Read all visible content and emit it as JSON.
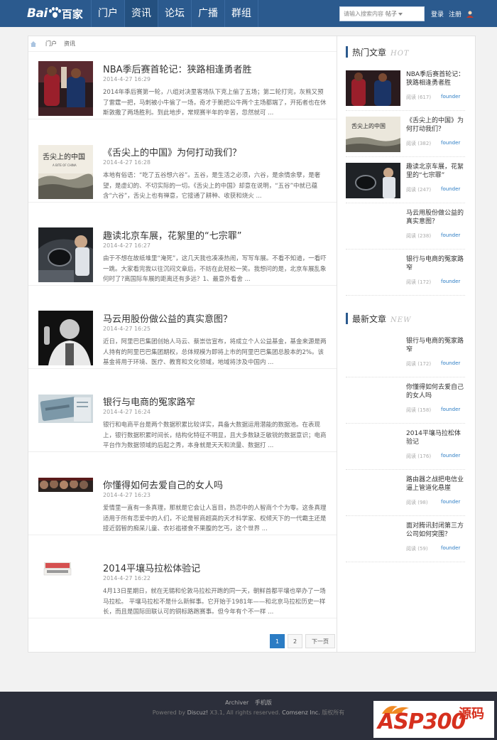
{
  "header": {
    "logo_text_bai": "Bai",
    "logo_text_du": "du",
    "logo_text_baijia": "百家",
    "nav": [
      {
        "label": "门户"
      },
      {
        "label": "资讯"
      },
      {
        "label": "论坛"
      },
      {
        "label": "广播"
      },
      {
        "label": "群组"
      }
    ],
    "active_nav": "资讯",
    "search_placeholder": "请输入搜索内容",
    "search_scope": "帖子",
    "login": "登录",
    "register": "注册"
  },
  "breadcrumb": [
    "门户",
    "资讯"
  ],
  "articles": [
    {
      "title": "NBA季后赛首轮记：狭路相逢勇者胜",
      "date": "2014-4-27 16:29",
      "desc": "2014年季后赛第一轮，八组对决里客场队下克上偷了五场；第二轮打完，灰熊又预了雷霆一把，马刺被小牛偷了一场，奇才于脆把公牛两个主场都端了，开拓者也在休斯敦撒了两场胜利。到此地步，常规赛半年的辛苦，忽然就可 ..."
    },
    {
      "title": "《舌尖上的中国》为何打动我们？",
      "date": "2014-4-27 16:28",
      "desc": "本地有俗语：“吃了五谷想六谷”。五谷，是生活之必须，六谷，是余情余孽，是奢望，是虚幻的、不切实际的一切。《舌尖上的中国》却意在说明，“五谷”中就已蕴含“六谷”，舌尖上也有禅意，它接通了耕种、收获和烧火 ..."
    },
    {
      "title": "趣读北京车展，花絮里的“七宗罪”",
      "date": "2014-4-27 16:27",
      "desc": "由于不想在故纸堆里“淹死”，这几天我也凑凑热闹，写写车展。不看不知道，一看吓一跳。大家看完我以往沉闷文章后，不妨在此轻松一笑。我想问的是，北京车展乱象何时了?离国际车展的距离还有多远？1、最意外看舍 ..."
    },
    {
      "title": "马云用股份做公益的真实意图？",
      "date": "2014-4-27 16:25",
      "desc": "近日，阿里巴巴集团创始人马云、蔡崇信宣布，将成立个人公益基金，基金来源是两人持有的阿里巴巴集团期权，总体规模为即将上市的阿里巴巴集团总股本的2%。该基金将用于环境、医疗、教育和文化领域，地域将涉及中国内 ..."
    },
    {
      "title": "银行与电商的冤家路窄",
      "date": "2014-4-27 16:24",
      "desc": "银行和电商平台是两个数据积累比较详实，具备大数据运用潜能的数据池。在表现上，银行数据积累时间长，结构化特征不明显，且大多数缺乏敏锐的数据意识；电商平台作为数据领域的后起之秀，本身就是天天和流量、数据打 ..."
    },
    {
      "title": "你懂得如何去爱自己的女人吗",
      "date": "2014-4-27 16:23",
      "desc": "爱情里一直有一条真理，那就是它会让人盲目，热恋中的人智商个个为零。这条真理适用于所有恋爱中的人们，不论是智商超高的天才科学家、权倾天下的一代霸主还是接近弱智的痴呆儿童、衣衫褴褛食不果腹的乞丐，这个世界 ..."
    },
    {
      "title": "2014平壤马拉松体验记",
      "date": "2014-4-27 16:22",
      "desc": "4月13日星期日，就在无锡和伦敦马拉松开跑的同一天，朝鲜首都平壤也举办了一场马拉松。 平壤马拉松不是什么新鲜事。它开始于1981年——和北京马拉松历史一样长，而且是国际田联认可的铜标路跑赛事。但今年有个不一样 ..."
    }
  ],
  "pager": {
    "pages": [
      "1",
      "2"
    ],
    "current": "1",
    "next": "下一页"
  },
  "hot": {
    "title_cn": "热门文章",
    "title_en": "HOT",
    "items": [
      {
        "title": "NBA季后赛首轮记：狭路相逢勇者胜",
        "views": "阅读 (617)",
        "author": "founder"
      },
      {
        "title": "《舌尖上的中国》为何打动我们？",
        "views": "阅读 (382)",
        "author": "founder"
      },
      {
        "title": "趣读北京车展，花絮里的“七宗罪”",
        "views": "阅读 (247)",
        "author": "founder"
      },
      {
        "title": "马云用股份做公益的真实意图？",
        "views": "阅读 (238)",
        "author": "founder"
      },
      {
        "title": "银行与电商的冤家路窄",
        "views": "阅读 (172)",
        "author": "founder"
      }
    ]
  },
  "new": {
    "title_cn": "最新文章",
    "title_en": "NEW",
    "items": [
      {
        "title": "银行与电商的冤家路窄",
        "views": "阅读 (172)",
        "author": "founder"
      },
      {
        "title": "你懂得如何去爱自己的女人吗",
        "views": "阅读 (158)",
        "author": "founder"
      },
      {
        "title": "2014平壤马拉松体验记",
        "views": "阅读 (176)",
        "author": "founder"
      },
      {
        "title": "路由器之战把电信业逼上管道化悬崖",
        "views": "阅读 (98)",
        "author": "founder"
      },
      {
        "title": "面对腾讯封闭第三方公司如何突围？",
        "views": "阅读 (59)",
        "author": "founder"
      }
    ]
  },
  "footer": {
    "links": [
      "Archiver",
      "手机版"
    ],
    "powered_prefix": "Powered by",
    "product": "Discuz!",
    "version": "X3.1",
    "rights": ", All rights reserved.",
    "company": "Comsenz Inc.",
    "copyright": "版权所有"
  },
  "watermark": {
    "text": "ASP300",
    "suffix": "源码"
  },
  "colors": {
    "nav_bg": "#2b5a8e",
    "accent": "#2b7cc4",
    "footer_bg": "#2c2f3b"
  }
}
